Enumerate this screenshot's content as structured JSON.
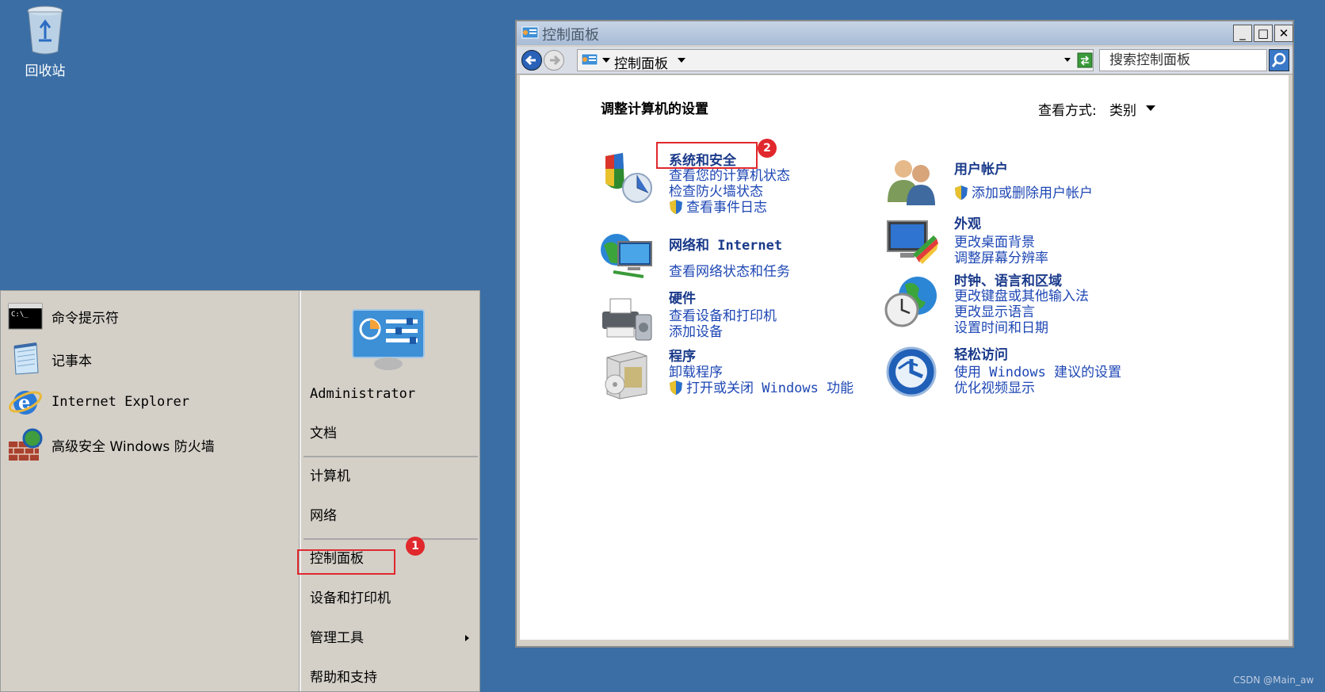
{
  "desktop": {
    "recycle_bin_label": "回收站"
  },
  "start_menu": {
    "programs": [
      {
        "label": "命令提示符",
        "icon": "cmd-icon"
      },
      {
        "label": "记事本",
        "icon": "notepad-icon"
      },
      {
        "label": "Internet Explorer",
        "icon": "ie-icon"
      },
      {
        "label": "高级安全 Windows 防火墙",
        "icon": "firewall-icon"
      }
    ],
    "right_links": {
      "user": "Administrator",
      "documents": "文档",
      "computer": "计算机",
      "network": "网络",
      "control_panel": "控制面板",
      "devices_printers": "设备和打印机",
      "admin_tools": "管理工具",
      "help_support": "帮助和支持"
    },
    "annotation_1": "1"
  },
  "control_panel": {
    "window_title": "控制面板",
    "breadcrumb": "控制面板",
    "search_placeholder": "搜索控制面板",
    "heading": "调整计算机的设置",
    "view_by_label": "查看方式:",
    "view_by_value": "类别",
    "annotation_2": "2",
    "left_categories": [
      {
        "title": "系统和安全",
        "icon": "system-security-icon",
        "links": [
          "查看您的计算机状态",
          "检查防火墙状态",
          "查看事件日志"
        ]
      },
      {
        "title": "网络和 Internet",
        "icon": "network-internet-icon",
        "links": [
          "查看网络状态和任务"
        ]
      },
      {
        "title": "硬件",
        "icon": "hardware-icon",
        "links": [
          "查看设备和打印机",
          "添加设备"
        ]
      },
      {
        "title": "程序",
        "icon": "programs-icon",
        "links": [
          "卸载程序",
          "打开或关闭 Windows 功能"
        ]
      }
    ],
    "right_categories": [
      {
        "title": "用户帐户",
        "icon": "user-accounts-icon",
        "links": [
          "添加或删除用户帐户"
        ]
      },
      {
        "title": "外观",
        "icon": "appearance-icon",
        "links": [
          "更改桌面背景",
          "调整屏幕分辨率"
        ]
      },
      {
        "title": "时钟、语言和区域",
        "icon": "clock-language-icon",
        "links": [
          "更改键盘或其他输入法",
          "更改显示语言",
          "设置时间和日期"
        ]
      },
      {
        "title": "轻松访问",
        "icon": "ease-of-access-icon",
        "links": [
          "使用 Windows 建议的设置",
          "优化视频显示"
        ]
      }
    ]
  },
  "watermark": "CSDN @Main_aw",
  "colors": {
    "desktop": "#3a6ea5",
    "annotation_red": "#e0282d",
    "link_blue": "#1e47b4"
  }
}
